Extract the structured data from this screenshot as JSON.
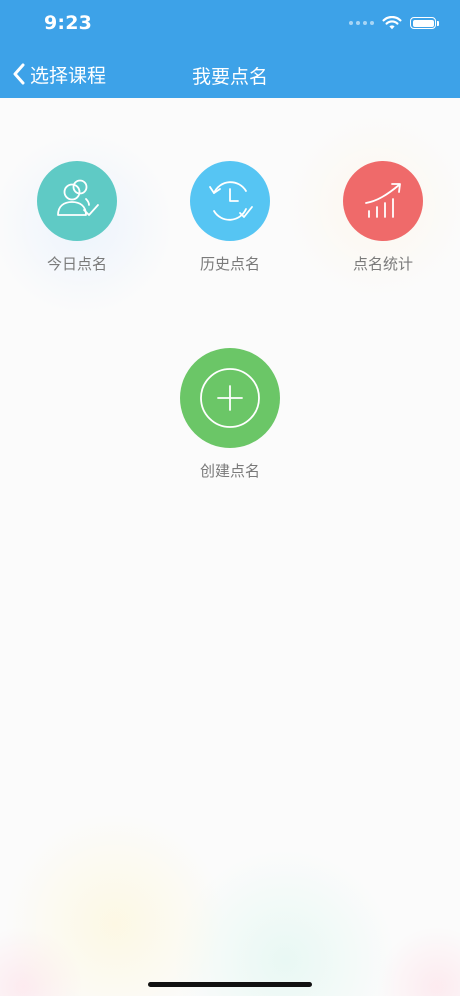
{
  "status_bar": {
    "time": "9:23",
    "icons": [
      "signal-dots-icon",
      "wifi-icon",
      "battery-icon"
    ]
  },
  "nav": {
    "back_label": "选择课程",
    "back_icon": "chevron-left-icon",
    "title": "我要点名"
  },
  "tiles": {
    "today": {
      "label": "今日点名",
      "icon": "users-check-icon",
      "color": "#5fcac5"
    },
    "history": {
      "label": "历史点名",
      "icon": "clock-history-icon",
      "color": "#56c5f3"
    },
    "stats": {
      "label": "点名统计",
      "icon": "bar-chart-trend-icon",
      "color": "#ef6a6a"
    },
    "create": {
      "label": "创建点名",
      "icon": "plus-circle-icon",
      "color": "#6bc667"
    }
  },
  "colors": {
    "header_bg": "#3da2e8",
    "label_text": "#7a7a7a"
  }
}
